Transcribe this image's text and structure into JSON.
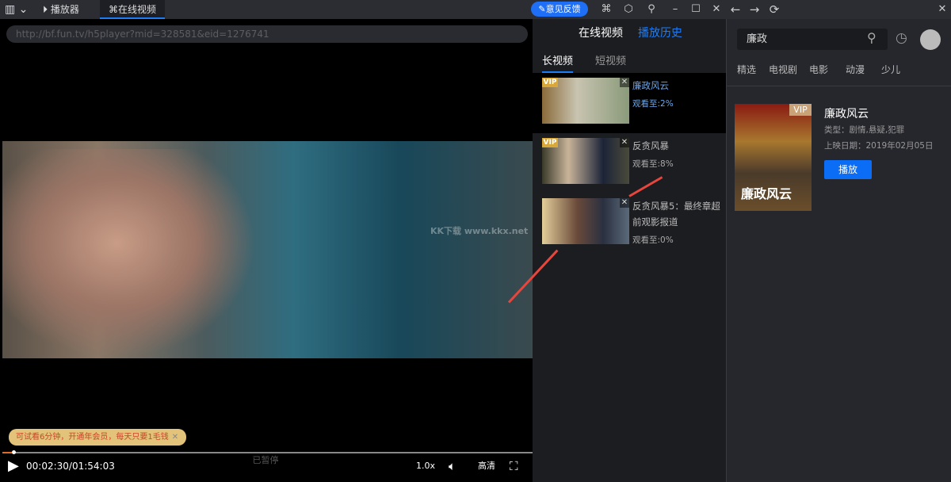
{
  "topbar": {
    "tabs": [
      {
        "label": "播放器",
        "icon": "play-circle-icon"
      },
      {
        "label": "在线视频",
        "icon": "grid-icon",
        "active": true
      }
    ],
    "feedback": "意见反馈"
  },
  "player": {
    "url": "http://bf.fun.tv/h5player?mid=328581&eid=1276741",
    "trial_notice": "可试看6分钟，开通年会员，每天只要1毛钱",
    "time": "00:02:30/01:54:03",
    "paused": "已暂停",
    "speed": "1.0x",
    "quality": "高清",
    "progress_percent": 2.2,
    "watermark": "KK下载 www.kkx.net"
  },
  "panel": {
    "tabs": [
      "在线视频",
      "播放历史"
    ],
    "subtabs": [
      "长视频",
      "短视频"
    ],
    "items": [
      {
        "title": "廉政风云",
        "progress": "观看至:2%",
        "vip": "VIP",
        "active": true
      },
      {
        "title": "反贪风暴",
        "progress": "观看至:8%",
        "vip": "VIP"
      },
      {
        "title": "反贪风暴5：最终章超前观影报道",
        "progress": "观看至:0%"
      }
    ]
  },
  "browser": {
    "search": "廉政",
    "categories": [
      "精选",
      "电视剧",
      "电影",
      "动漫",
      "少儿"
    ],
    "result": {
      "title": "廉政风云",
      "vip": "VIP",
      "genre": "类型：剧情,悬疑,犯罪",
      "date": "上映日期：2019年02月05日",
      "play": "播放",
      "poster_text": "廉政风云"
    }
  },
  "colors": {
    "accent": "#1e7df5",
    "vip": "#d8a83a",
    "arrow": "#e8453c"
  }
}
